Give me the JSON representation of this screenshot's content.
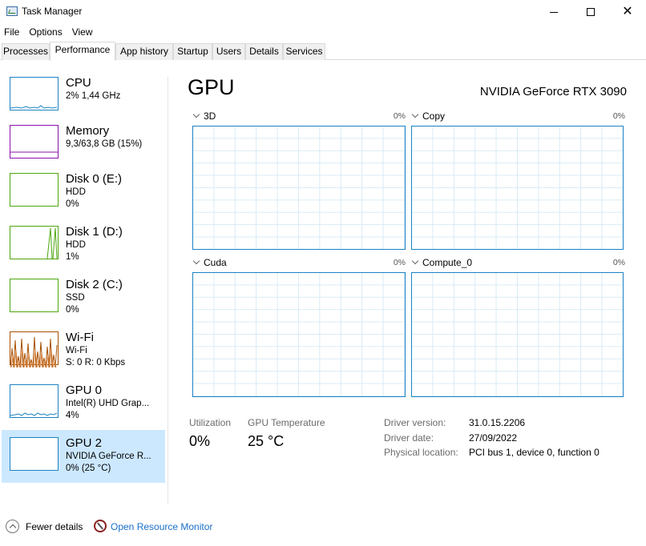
{
  "window": {
    "title": "Task Manager"
  },
  "menu": [
    "File",
    "Options",
    "View"
  ],
  "tabs": [
    "Processes",
    "Performance",
    "App history",
    "Startup",
    "Users",
    "Details",
    "Services"
  ],
  "active_tab": "Performance",
  "sidebar": [
    {
      "title": "CPU",
      "lines": [
        "2% 1,44 GHz"
      ],
      "accent": "#1c83c4",
      "selected": false
    },
    {
      "title": "Memory",
      "lines": [
        "9,3/63,8 GB (15%)"
      ],
      "accent": "#8b12ae",
      "selected": false
    },
    {
      "title": "Disk 0 (E:)",
      "lines": [
        "HDD",
        "0%"
      ],
      "accent": "#4da60c",
      "selected": false
    },
    {
      "title": "Disk 1 (D:)",
      "lines": [
        "HDD",
        "1%"
      ],
      "accent": "#4da60c",
      "selected": false
    },
    {
      "title": "Disk 2 (C:)",
      "lines": [
        "SSD",
        "0%"
      ],
      "accent": "#4da60c",
      "selected": false
    },
    {
      "title": "Wi-Fi",
      "lines": [
        "Wi-Fi",
        "S: 0 R: 0 Kbps"
      ],
      "accent": "#a74f01",
      "selected": false
    },
    {
      "title": "GPU 0",
      "lines": [
        "Intel(R) UHD Grap...",
        "4%"
      ],
      "accent": "#1c83c4",
      "selected": false
    },
    {
      "title": "GPU 2",
      "lines": [
        "NVIDIA GeForce R...",
        "0% (25 °C)"
      ],
      "accent": "#1c83c4",
      "selected": true
    }
  ],
  "main": {
    "title": "GPU",
    "model": "NVIDIA GeForce RTX 3090",
    "graphs": [
      {
        "label": "3D",
        "pct": "0%"
      },
      {
        "label": "Copy",
        "pct": "0%"
      },
      {
        "label": "Cuda",
        "pct": "0%"
      },
      {
        "label": "Compute_0",
        "pct": "0%"
      }
    ],
    "stats": {
      "utilization_label": "Utilization",
      "utilization_value": "0%",
      "temp_label": "GPU Temperature",
      "temp_value": "25 °C"
    },
    "info": {
      "driver_version_label": "Driver version:",
      "driver_version": "31.0.15.2206",
      "driver_date_label": "Driver date:",
      "driver_date": "27/09/2022",
      "physical_location_label": "Physical location:",
      "physical_location": "PCI bus 1, device 0, function 0"
    }
  },
  "footer": {
    "fewer_details": "Fewer details",
    "open_resource_monitor": "Open Resource Monitor"
  },
  "colors": {
    "gpu_accent": "#1c83c4",
    "selected_bg": "#cce8ff",
    "link": "#1a6fc9"
  }
}
